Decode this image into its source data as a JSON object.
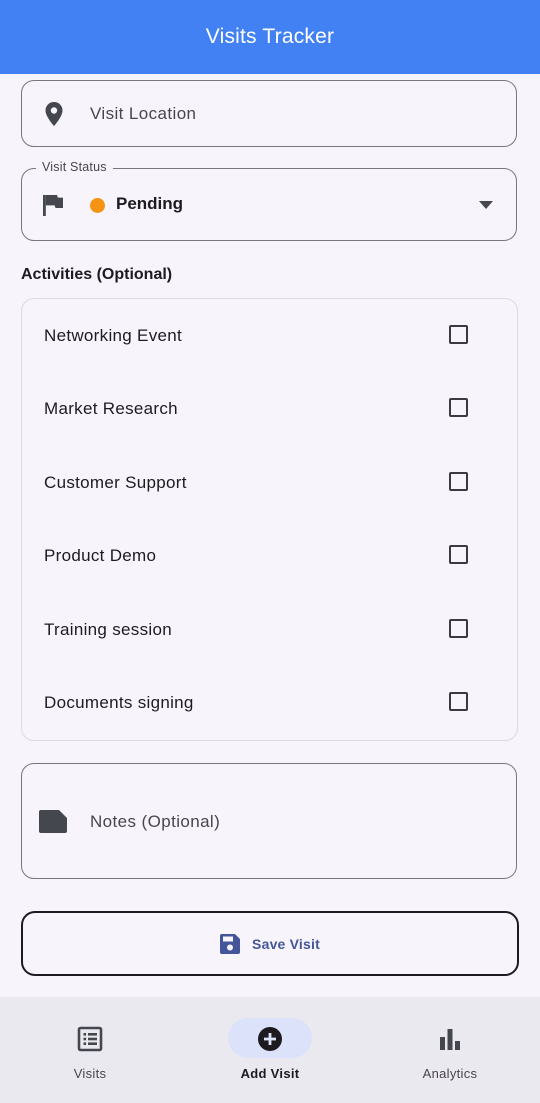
{
  "app": {
    "title": "Visits Tracker"
  },
  "location": {
    "placeholder": "Visit Location",
    "icon": "location-pin-icon"
  },
  "status": {
    "label": "Visit Status",
    "value": "Pending",
    "dot_color": "#f59414",
    "icon": "flag-icon"
  },
  "activities": {
    "title": "Activities (Optional)",
    "items": [
      {
        "label": "Networking Event",
        "checked": false
      },
      {
        "label": "Market Research",
        "checked": false
      },
      {
        "label": "Customer Support",
        "checked": false
      },
      {
        "label": "Product Demo",
        "checked": false
      },
      {
        "label": "Training session",
        "checked": false
      },
      {
        "label": "Documents signing",
        "checked": false
      }
    ]
  },
  "notes": {
    "placeholder": "Notes (Optional)",
    "icon": "note-icon"
  },
  "save": {
    "label": "Save Visit",
    "icon": "save-icon"
  },
  "nav": {
    "items": [
      {
        "label": "Visits",
        "icon": "list-icon",
        "active": false
      },
      {
        "label": "Add Visit",
        "icon": "add-circle-icon",
        "active": true
      },
      {
        "label": "Analytics",
        "icon": "bar-chart-icon",
        "active": false
      }
    ]
  },
  "colors": {
    "app_bar": "#4281f4",
    "accent_text": "#44559a",
    "active_pill": "#dbe2fa"
  }
}
